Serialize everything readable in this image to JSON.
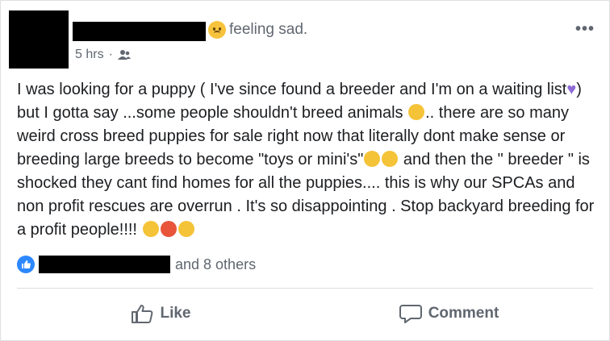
{
  "post": {
    "feeling": "feeling sad.",
    "time": "5 hrs",
    "separator": "·",
    "body_part1": "I was looking for a puppy ( I've since found a breeder and I'm on a waiting list",
    "body_part2": ") but I gotta say ...some people shouldn't breed animals ",
    "body_part3": ".. there are so many weird cross breed puppies for sale right now that literally dont make sense or breeding large breeds to become \"toys or mini's\"",
    "body_part4": " and then the \" breeder \" is shocked they cant find homes for all the puppies.... this is why our SPCAs and non profit rescues are overrun . It's so disappointing . Stop backyard breeding for a profit people!!!! ",
    "more_icon": "•••"
  },
  "reactions": {
    "others_text": "and 8 others"
  },
  "actions": {
    "like_label": "Like",
    "comment_label": "Comment"
  },
  "colors": {
    "text": "#1c1e21",
    "muted": "#606770",
    "like_blue": "#2d88ff",
    "divider": "#dadde1"
  }
}
